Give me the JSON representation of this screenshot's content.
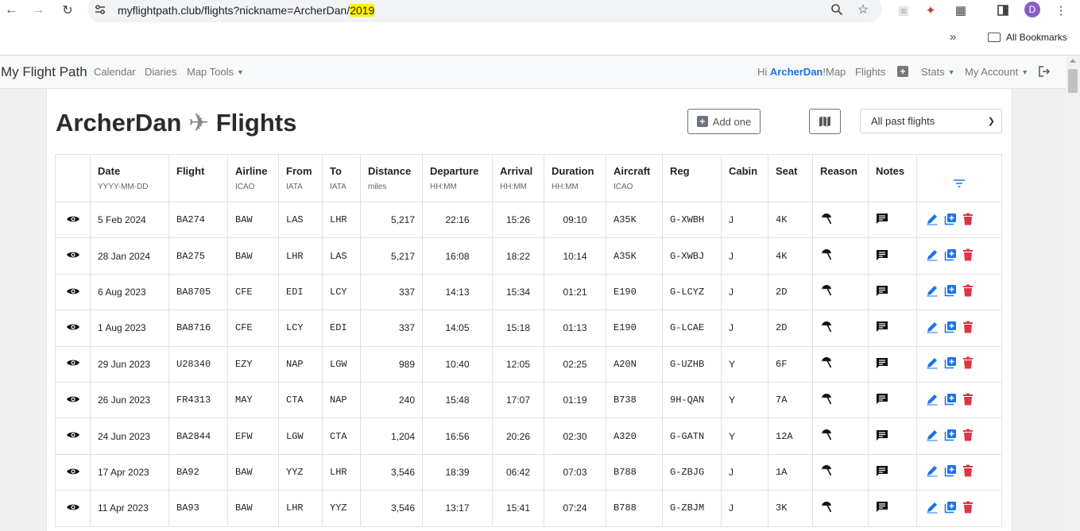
{
  "browser": {
    "url_main": "myflightpath.club/flights?nickname=ArcherDan/",
    "url_highlight": "2019",
    "avatar_letter": "D",
    "all_bookmarks": "All Bookmarks"
  },
  "nav": {
    "brand": "My Flight Path",
    "calendar": "Calendar",
    "diaries": "Diaries",
    "map_tools": "Map Tools",
    "greeting": "Hi",
    "user": "ArcherDan",
    "exclaim": "!",
    "map": "Map",
    "flights": "Flights",
    "stats": "Stats",
    "account": "My Account"
  },
  "page": {
    "title_user": "ArcherDan",
    "title_plane": "✈",
    "title_rest": "Flights",
    "add_label": "Add one",
    "filter_selected": "All past flights"
  },
  "colors": {
    "accent_blue": "#1a73e8",
    "delete_red": "#dc3545"
  },
  "table": {
    "headers": [
      {
        "label": "",
        "sub": ""
      },
      {
        "label": "Date",
        "sub": "YYYY-MM-DD"
      },
      {
        "label": "Flight",
        "sub": ""
      },
      {
        "label": "Airline",
        "sub": "ICAO"
      },
      {
        "label": "From",
        "sub": "IATA"
      },
      {
        "label": "To",
        "sub": "IATA"
      },
      {
        "label": "Distance",
        "sub": "miles"
      },
      {
        "label": "Departure",
        "sub": "HH:MM"
      },
      {
        "label": "Arrival",
        "sub": "HH:MM"
      },
      {
        "label": "Duration",
        "sub": "HH:MM"
      },
      {
        "label": "Aircraft",
        "sub": "ICAO"
      },
      {
        "label": "Reg",
        "sub": ""
      },
      {
        "label": "Cabin",
        "sub": ""
      },
      {
        "label": "Seat",
        "sub": ""
      },
      {
        "label": "Reason",
        "sub": ""
      },
      {
        "label": "Notes",
        "sub": ""
      },
      {
        "label": "",
        "sub": ""
      }
    ],
    "rows": [
      {
        "date": "5 Feb 2024",
        "flight": "BA274",
        "airline": "BAW",
        "from": "LAS",
        "to": "LHR",
        "distance": "5,217",
        "departure": "22:16",
        "arrival": "15:26",
        "duration": "09:10",
        "aircraft": "A35K",
        "reg": "G-XWBH",
        "cabin": "J",
        "seat": "4K"
      },
      {
        "date": "28 Jan 2024",
        "flight": "BA275",
        "airline": "BAW",
        "from": "LHR",
        "to": "LAS",
        "distance": "5,217",
        "departure": "16:08",
        "arrival": "18:22",
        "duration": "10:14",
        "aircraft": "A35K",
        "reg": "G-XWBJ",
        "cabin": "J",
        "seat": "4K"
      },
      {
        "date": "6 Aug 2023",
        "flight": "BA8705",
        "airline": "CFE",
        "from": "EDI",
        "to": "LCY",
        "distance": "337",
        "departure": "14:13",
        "arrival": "15:34",
        "duration": "01:21",
        "aircraft": "E190",
        "reg": "G-LCYZ",
        "cabin": "J",
        "seat": "2D"
      },
      {
        "date": "1 Aug 2023",
        "flight": "BA8716",
        "airline": "CFE",
        "from": "LCY",
        "to": "EDI",
        "distance": "337",
        "departure": "14:05",
        "arrival": "15:18",
        "duration": "01:13",
        "aircraft": "E190",
        "reg": "G-LCAE",
        "cabin": "J",
        "seat": "2D"
      },
      {
        "date": "29 Jun 2023",
        "flight": "U28340",
        "airline": "EZY",
        "from": "NAP",
        "to": "LGW",
        "distance": "989",
        "departure": "10:40",
        "arrival": "12:05",
        "duration": "02:25",
        "aircraft": "A20N",
        "reg": "G-UZHB",
        "cabin": "Y",
        "seat": "6F"
      },
      {
        "date": "26 Jun 2023",
        "flight": "FR4313",
        "airline": "MAY",
        "from": "CTA",
        "to": "NAP",
        "distance": "240",
        "departure": "15:48",
        "arrival": "17:07",
        "duration": "01:19",
        "aircraft": "B738",
        "reg": "9H-QAN",
        "cabin": "Y",
        "seat": "7A"
      },
      {
        "date": "24 Jun 2023",
        "flight": "BA2844",
        "airline": "EFW",
        "from": "LGW",
        "to": "CTA",
        "distance": "1,204",
        "departure": "16:56",
        "arrival": "20:26",
        "duration": "02:30",
        "aircraft": "A320",
        "reg": "G-GATN",
        "cabin": "Y",
        "seat": "12A"
      },
      {
        "date": "17 Apr 2023",
        "flight": "BA92",
        "airline": "BAW",
        "from": "YYZ",
        "to": "LHR",
        "distance": "3,546",
        "departure": "18:39",
        "arrival": "06:42",
        "duration": "07:03",
        "aircraft": "B788",
        "reg": "G-ZBJG",
        "cabin": "J",
        "seat": "1A"
      },
      {
        "date": "11 Apr 2023",
        "flight": "BA93",
        "airline": "BAW",
        "from": "LHR",
        "to": "YYZ",
        "distance": "3,546",
        "departure": "13:17",
        "arrival": "15:41",
        "duration": "07:24",
        "aircraft": "B788",
        "reg": "G-ZBJM",
        "cabin": "J",
        "seat": "3K"
      }
    ]
  }
}
